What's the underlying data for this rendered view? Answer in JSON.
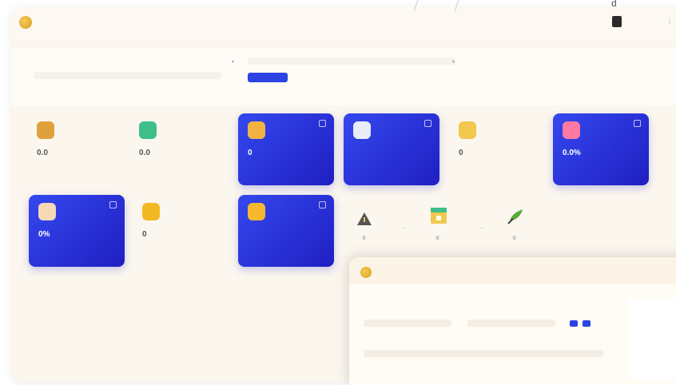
{
  "app": {
    "user": {
      "name": ""
    }
  },
  "filters": {
    "date_from_label": "",
    "date_from_value": "",
    "date_to_value": "",
    "search_button": ""
  },
  "cards": [
    {
      "id": "c1",
      "value": "0.0",
      "label": "",
      "style": "white",
      "icon": "money-bag-icon",
      "icon_color": "#e0a13c"
    },
    {
      "id": "c2",
      "value": "0.0",
      "label": "",
      "style": "white",
      "icon": "bell-icon",
      "icon_color": "#3ebf8a"
    },
    {
      "id": "c3",
      "value": "0",
      "label": "",
      "style": "blue",
      "icon": "person-icon",
      "icon_color": "#f3b344"
    },
    {
      "id": "c4",
      "value": "",
      "label": "",
      "style": "blue",
      "icon": "document-icon",
      "icon_color": "#e8edf7"
    },
    {
      "id": "c5",
      "value": "0",
      "label": "",
      "style": "white",
      "icon": "handshake-icon",
      "icon_color": "#f2c84d"
    },
    {
      "id": "c6",
      "value": "0.0%",
      "label": "",
      "style": "blue",
      "icon": "pie-chart-icon",
      "icon_color": "#ff7aa3"
    },
    {
      "id": "c7",
      "value": "0%",
      "label": "",
      "style": "blue",
      "icon": "store-icon",
      "icon_color": "#f6d7b6"
    },
    {
      "id": "c8",
      "value": "0",
      "label": "",
      "style": "white",
      "icon": "coin-icon",
      "icon_color": "#f2b824"
    },
    {
      "id": "c9",
      "value": "",
      "label": "",
      "style": "blue",
      "icon": "trophy-icon",
      "icon_color": "#f5b82e"
    }
  ],
  "flow": {
    "steps": [
      {
        "name": "",
        "value": "0",
        "icon": "warning-icon"
      },
      {
        "name": "",
        "value": "0",
        "icon": "calendar-icon"
      },
      {
        "name": "",
        "value": "0",
        "icon": "plant-icon"
      }
    ],
    "arrows": [
      "",
      ""
    ]
  },
  "popup": {
    "date_from_label": "",
    "date_from_value": "",
    "date_to_label": "",
    "date_to_value": "",
    "type_label": "",
    "type_value": ""
  }
}
